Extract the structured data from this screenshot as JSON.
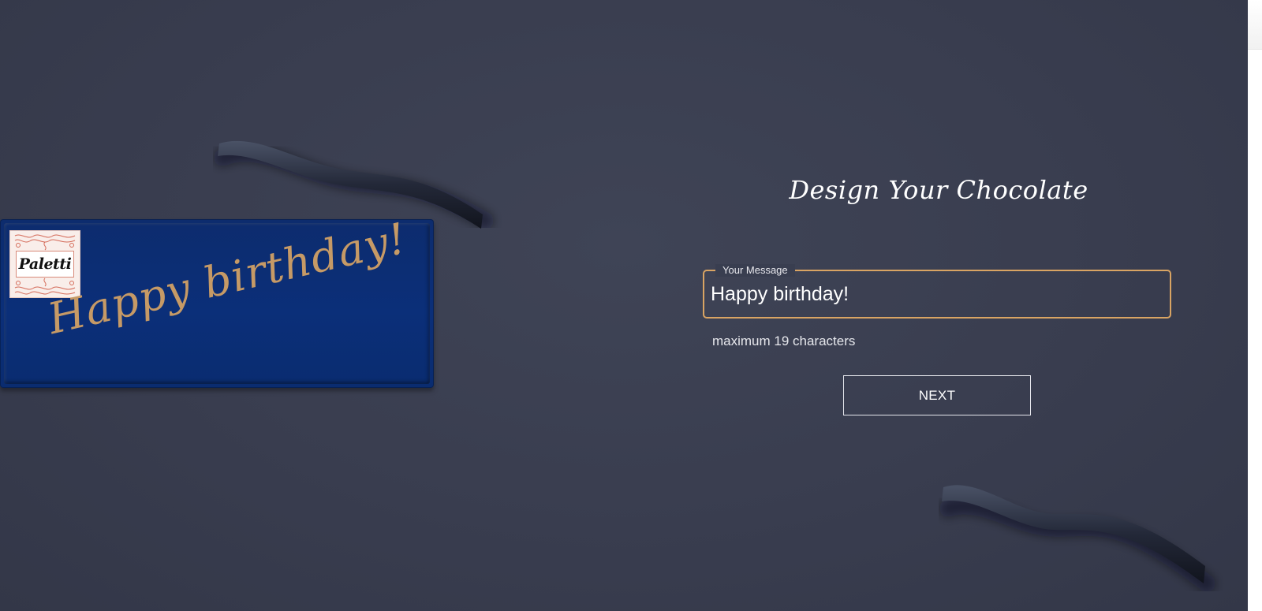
{
  "preview": {
    "logo_text": "Paletti",
    "message": "Happy birthday!",
    "bar_color": "#0b2f79",
    "text_color": "#c69a66"
  },
  "form": {
    "title": "Design Your Chocolate",
    "message_label": "Your Message",
    "message_value": "Happy birthday!",
    "hint": "maximum 19 characters",
    "next_label": "NEXT"
  },
  "theme": {
    "background": "#393d4f",
    "accent": "#d9a463"
  }
}
